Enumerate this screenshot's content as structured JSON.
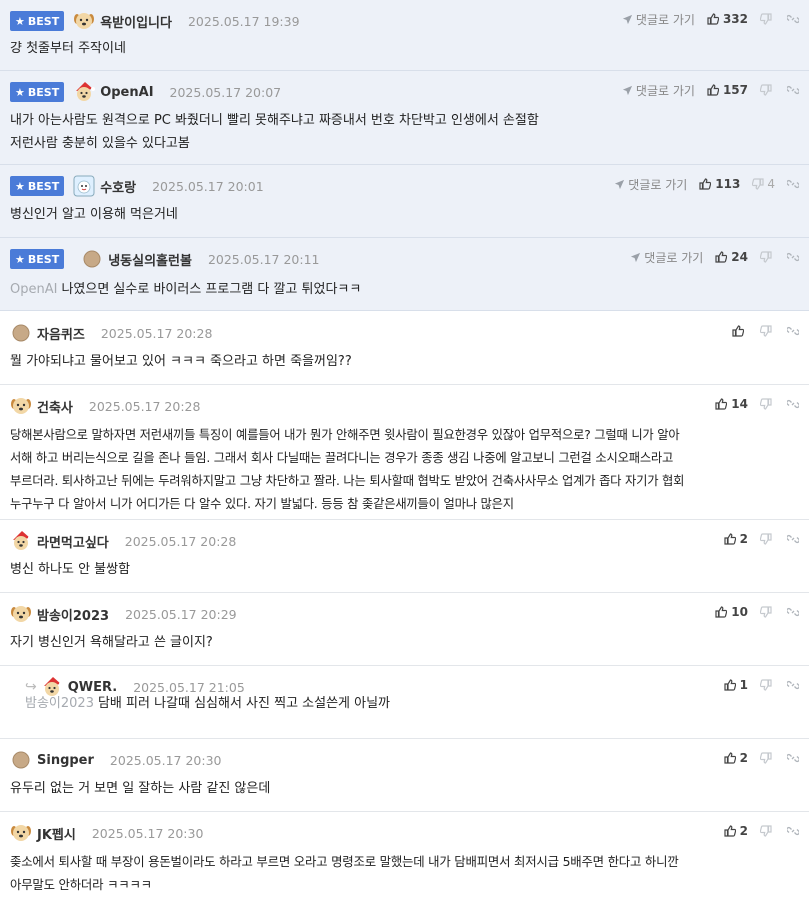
{
  "labels": {
    "best": "BEST",
    "reply_to": "댓글로 가기"
  },
  "comments": [
    {
      "best": true,
      "avatar": "dog",
      "nick": "욕받이입니다",
      "date": "2025.05.17 19:39",
      "likes": "332",
      "dislikes": "",
      "text": [
        "걍 첫줄부터 주작이네"
      ]
    },
    {
      "best": true,
      "avatar": "santa",
      "nick": "OpenAI",
      "date": "2025.05.17 20:07",
      "likes": "157",
      "dislikes": "",
      "text": [
        "내가 아는사람도 원격으로 PC 봐줬더니 빨리 못해주냐고 짜증내서 번호 차단박고 인생에서 손절함",
        "저런사람 충분히 있을수 있다고봄"
      ]
    },
    {
      "best": true,
      "avatar": "snowman",
      "nick": "수호랑",
      "date": "2025.05.17 20:01",
      "likes": "113",
      "dislikes": "4",
      "text": [
        "병신인거 알고 이용해 먹은거네"
      ]
    },
    {
      "best": true,
      "avatar": "circle",
      "nick": "냉동실의홀런볼",
      "date": "2025.05.17 20:11",
      "likes": "24",
      "dislikes": "",
      "mention": "OpenAI",
      "text": [
        "나였으면 실수로 바이러스 프로그램 다 깔고 튀었다ㅋㅋ"
      ]
    },
    {
      "best": false,
      "avatar": "circle",
      "nick": "자음퀴즈",
      "date": "2025.05.17 20:28",
      "likes": "",
      "dislikes": "",
      "text": [
        "뭘 가야되냐고 물어보고 있어 ㅋㅋㅋ 죽으라고 하면 죽을꺼임??"
      ]
    },
    {
      "best": false,
      "avatar": "dog",
      "nick": "건축사",
      "date": "2025.05.17 20:28",
      "likes": "14",
      "dislikes": "",
      "text": [
        "당해본사람으로 말하자면 저런새끼들 특징이 예를들어 내가 뭔가 안해주면 윗사람이 필요한경우 있잖아 업무적으로? 그럴때 니가 알아",
        "서해 하고 버리는식으로 길을 존나 들임. 그래서 회사 다닐때는 끌려다니는 경우가 종종 생김 나중에 알고보니 그런걸 소시오패스라고",
        "부르더라. 퇴사하고난 뒤에는 두려워하지말고 그냥 차단하고 짤라. 나는 퇴사할때 협박도 받았어 건축사사무소 업계가 좁다 자기가 협회",
        "누구누구 다 알아서 니가 어디가든 다 알수 있다. 자기 발넓다. 등등 참 좆같은새끼들이 얼마나 많은지"
      ]
    },
    {
      "best": false,
      "avatar": "santa",
      "nick": "라면먹고싶다",
      "date": "2025.05.17 20:28",
      "likes": "2",
      "dislikes": "",
      "text": [
        "병신 하나도 안 불쌍함"
      ]
    },
    {
      "best": false,
      "avatar": "dog",
      "nick": "밤송이2023",
      "date": "2025.05.17 20:29",
      "likes": "10",
      "dislikes": "",
      "text": [
        "자기 병신인거 욕해달라고 쓴 글이지?"
      ]
    },
    {
      "best": false,
      "reply": true,
      "avatar": "santa",
      "nick": "QWER.",
      "date": "2025.05.17 21:05",
      "likes": "1",
      "dislikes": "",
      "mention": "밤송이2023",
      "text": [
        "담배 피러 나갈때 심심해서 사진 찍고 소설쓴게 아닐까"
      ]
    },
    {
      "best": false,
      "avatar": "circle",
      "nick": "Singper",
      "date": "2025.05.17 20:30",
      "likes": "2",
      "dislikes": "",
      "text": [
        "유두리 없는 거 보면 일 잘하는 사람 같진 않은데"
      ]
    },
    {
      "best": false,
      "avatar": "dog",
      "nick": "JK펩시",
      "date": "2025.05.17 20:30",
      "likes": "2",
      "dislikes": "",
      "text": [
        "좆소에서 퇴사할 때 부장이 용돈벌이라도 하라고 부르면 오라고 명령조로 말했는데 내가 담배피면서 최저시급 5배주면 한다고 하니깐",
        "아무말도 안하더라 ㅋㅋㅋㅋ"
      ]
    }
  ]
}
